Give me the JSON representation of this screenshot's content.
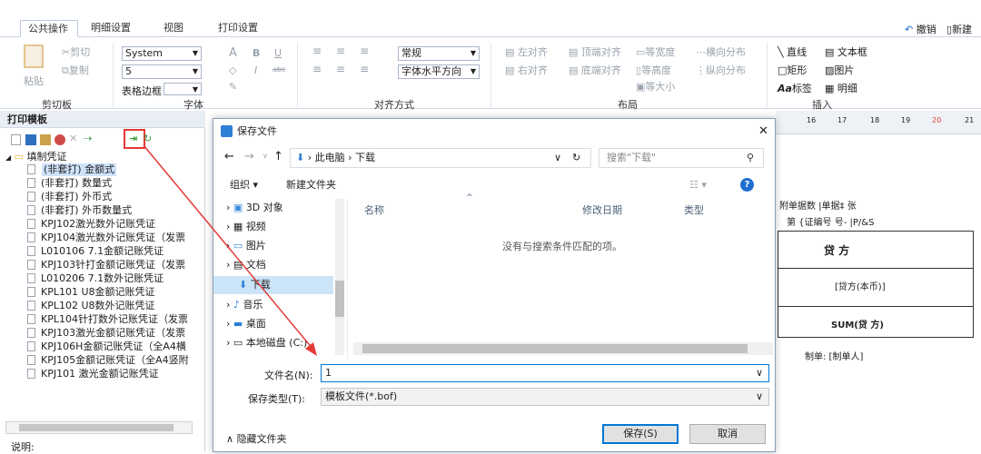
{
  "tabs": [
    "公共操作",
    "明细设置",
    "视图",
    "打印设置"
  ],
  "top_right": {
    "undo_label": "撤销",
    "new_label": "新建"
  },
  "ribbon": {
    "clipboard": {
      "paste": "粘贴",
      "cut": "剪切",
      "copy": "复制",
      "group": "剪切板"
    },
    "font": {
      "family": "System",
      "size": "5",
      "border_label": "表格边框",
      "group": "字体",
      "glyphs": [
        "A",
        "B",
        "U",
        "I",
        "abc"
      ]
    },
    "align": {
      "style": "常规",
      "direction": "字体水平方向",
      "group": "对齐方式"
    },
    "layout": {
      "items": [
        "左对齐",
        "顶端对齐",
        "等宽度",
        "横向分布",
        "右对齐",
        "底端对齐",
        "等高度",
        "纵向分布",
        "等大小"
      ],
      "group": "布局"
    },
    "insert": {
      "items": [
        "直线",
        "文本框",
        "矩形",
        "图片",
        "标签",
        "明细"
      ],
      "group": "插入"
    }
  },
  "panel": {
    "title": "打印模板",
    "root": "填制凭证",
    "items": [
      "(非套打) 金额式",
      "(非套打) 数量式",
      "(非套打) 外币式",
      "(非套打) 外币数量式",
      "KPJ102激光数外记账凭证",
      "KPJ104激光数外记账凭证（发票",
      "L010106 7.1金额记账凭证",
      "KPJ103针打金额记账凭证（发票",
      "L010206 7.1数外记账凭证",
      "KPL101 U8金额记账凭证",
      "KPL102 U8数外记账凭证",
      "KPL104针打数外记账凭证（发票",
      "KPJ103激光金额记账凭证（发票",
      "KPJ106H金额记账凭证（全A4横",
      "KPJ105金额记账凭证（全A4竖附",
      "KPJ101 激光金额记账凭证"
    ],
    "footer": "说明:"
  },
  "ruler": [
    "16",
    "17",
    "18",
    "19",
    "20",
    "21"
  ],
  "template_preview": {
    "row1": "附单据数 |单据‡  张",
    "row2": "第 {证编号 号- |P/&S",
    "credit": "贷  方",
    "credit_field": "[贷方(本币)]",
    "sum_field": "SUM(贷  方)",
    "maker": "制单: [制单人]"
  },
  "dialog": {
    "title": "保存文件",
    "path": [
      "此电脑",
      "下载"
    ],
    "search_placeholder": "搜索\"下载\"",
    "organize": "组织 ▾",
    "new_folder": "新建文件夹",
    "nav": [
      "3D 对象",
      "视频",
      "图片",
      "文档",
      "下载",
      "音乐",
      "桌面",
      "本地磁盘 (C:)"
    ],
    "columns": [
      "名称",
      "修改日期",
      "类型"
    ],
    "empty_message": "没有与搜索条件匹配的项。",
    "filename_label": "文件名(N):",
    "filename": "1",
    "filetype_label": "保存类型(T):",
    "filetype": "模板文件(*.bof)",
    "hide_folders": "隐藏文件夹",
    "save": "保存(S)",
    "cancel": "取消"
  },
  "colors": {
    "accent": "#0078d7",
    "annotation": "#e53935",
    "folder": "#e8b73a"
  }
}
